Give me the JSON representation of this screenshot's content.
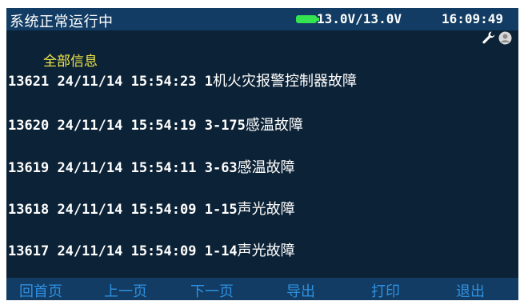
{
  "status_bar": {
    "status_text": "系统正常运行中",
    "voltage": "13.0V/13.0V",
    "time": "16:09:49",
    "battery_icon": "battery-icon",
    "wrench_icon": "wrench-icon",
    "user_icon": "user-icon",
    "battery_color": "#35e24f"
  },
  "content": {
    "title": "全部信息",
    "records": [
      {
        "id": "13621",
        "date": "24/11/14",
        "time": "15:54:23",
        "device": "1",
        "event": "机火灾报警控制器故障"
      },
      {
        "id": "13620",
        "date": "24/11/14",
        "time": "15:54:19",
        "device": "3-175",
        "event": "感温故障"
      },
      {
        "id": "13619",
        "date": "24/11/14",
        "time": "15:54:11",
        "device": "3-63",
        "event": "感温故障"
      },
      {
        "id": "13618",
        "date": "24/11/14",
        "time": "15:54:09",
        "device": "1-15",
        "event": "声光故障"
      },
      {
        "id": "13617",
        "date": "24/11/14",
        "time": "15:54:09",
        "device": "1-14",
        "event": "声光故障"
      }
    ]
  },
  "bottom_nav": {
    "home": "回首页",
    "prev": "上一页",
    "next": "下一页",
    "export": "导出",
    "print": "打印",
    "exit": "退出"
  },
  "colors": {
    "screen_bg": "#0c2236",
    "bar_bg": "#123c63",
    "title": "#f2e84a",
    "nav_text": "#2f90e0"
  }
}
